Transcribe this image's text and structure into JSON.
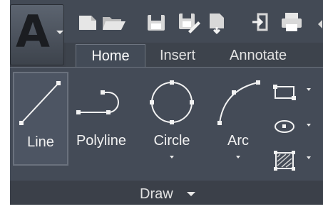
{
  "app_menu": {
    "letter": "A"
  },
  "quick_access": [
    {
      "icon": "new-file-icon"
    },
    {
      "icon": "open-folder-icon"
    },
    {
      "icon": "save-icon"
    },
    {
      "icon": "save-as-icon"
    },
    {
      "icon": "open-from-web-icon"
    },
    {
      "icon": "save-to-web-icon"
    },
    {
      "icon": "plot-icon"
    }
  ],
  "tabs": [
    {
      "label": "Home",
      "active": true
    },
    {
      "label": "Insert",
      "active": false
    },
    {
      "label": "Annotate",
      "active": false
    }
  ],
  "draw_panel": {
    "title": "Draw",
    "tools": [
      {
        "label": "Line",
        "icon": "line-icon",
        "selected": true
      },
      {
        "label": "Polyline",
        "icon": "polyline-icon",
        "selected": false
      },
      {
        "label": "Circle",
        "icon": "circle-icon",
        "selected": false,
        "has_dropdown": true
      },
      {
        "label": "Arc",
        "icon": "arc-icon",
        "selected": false,
        "has_dropdown": true
      }
    ],
    "small_tools": [
      {
        "icon": "rectangle-icon"
      },
      {
        "icon": "ellipse-icon"
      },
      {
        "icon": "hatch-icon"
      }
    ]
  },
  "colors": {
    "ribbon_background": "#444b57",
    "frame_background": "#3b4049",
    "text": "#f0f0f0"
  }
}
